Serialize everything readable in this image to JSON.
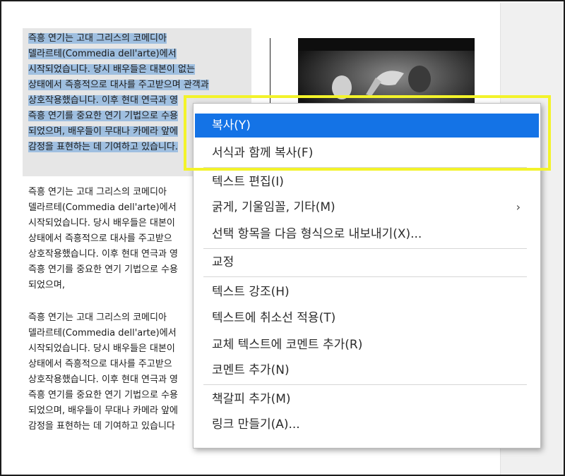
{
  "document": {
    "selected_paragraph": [
      "즉흥 연기는 고대 그리스의 코메디아",
      "델라르테(Commedia dell'arte)에서",
      "시작되었습니다. 당시 배우들은 대본이 없는",
      "상태에서 즉흥적으로 대사를 주고받으며 관객과",
      "상호작용했습니다. 이후 현대 연극과 영",
      "즉흥 연기를 중요한 연기 기법으로 수용",
      "되었으며, 배우들이 무대나 카메라 앞에",
      "감정을 표현하는 데 기여하고 있습니다."
    ],
    "paragraph2": [
      "즉흥 연기는 고대 그리스의 코메디아",
      "델라르테(Commedia dell'arte)에서",
      "시작되었습니다. 당시 배우들은 대본이",
      "상태에서 즉흥적으로 대사를 주고받으",
      "상호작용했습니다. 이후 현대 연극과 영",
      "즉흥 연기를 중요한 연기 기법으로 수용",
      "되었으며,"
    ],
    "paragraph3": [
      "즉흥 연기는 고대 그리스의 코메디아",
      "델라르테(Commedia dell'arte)에서",
      "시작되었습니다. 당시 배우들은 대본이",
      "상태에서 즉흥적으로 대사를 주고받으",
      "상호작용했습니다. 이후 현대 연극과 영",
      "즉흥 연기를 중요한 연기 기법으로 수용",
      "되었으며, 배우들이 무대나 카메라 앞에",
      "감정을 표현하는 데 기여하고 있습니다"
    ]
  },
  "context_menu": {
    "items": [
      {
        "label": "복사(Y)",
        "active": true
      },
      {
        "label": "서식과 함께 복사(F)"
      },
      {
        "label": "텍스트 편집(I)"
      },
      {
        "label": "굵게, 기울임꼴, 기타(M)",
        "submenu": true
      },
      {
        "label": "선택 항목을 다음 형식으로 내보내기(X)..."
      },
      {
        "label": "교정"
      },
      {
        "label": "텍스트 강조(H)"
      },
      {
        "label": "텍스트에 취소선 적용(T)"
      },
      {
        "label": "교체 텍스트에 코멘트 추가(R)"
      },
      {
        "label": "코멘트 추가(N)"
      },
      {
        "label": "책갈피 추가(M)"
      },
      {
        "label": "링크 만들기(A)..."
      }
    ],
    "submenu_icon": "chevron-right-icon"
  },
  "colors": {
    "selection": "#9fbfe0",
    "menu_active": "#1473e6",
    "highlight_box": "#f3f32a"
  }
}
